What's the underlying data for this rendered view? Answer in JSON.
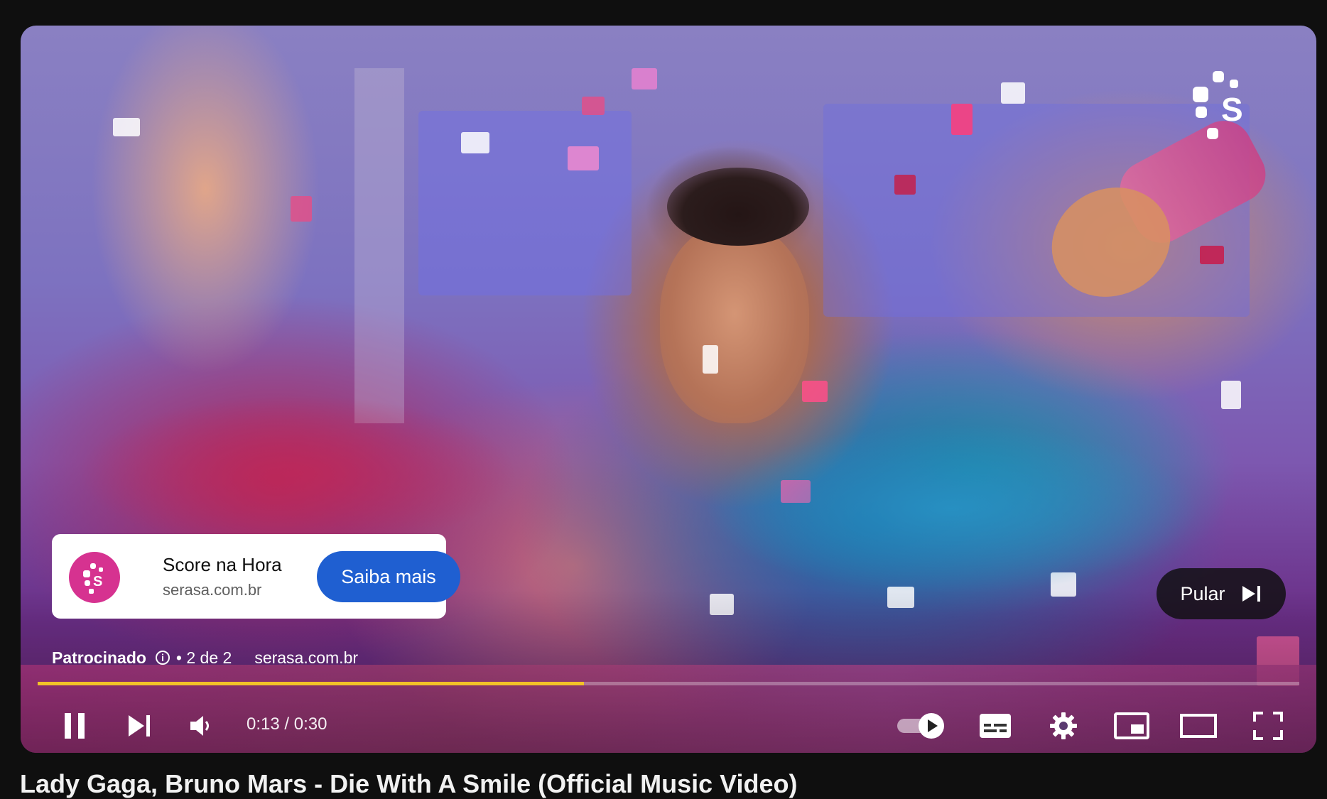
{
  "player": {
    "ad": {
      "advertiser_name": "Score na Hora",
      "advertiser_domain": "serasa.com.br",
      "cta_label": "Saiba mais",
      "sponsored_label": "Patrocinado",
      "ad_count": "• 2 de 2",
      "meta_domain": "serasa.com.br"
    },
    "skip_label": "Pular",
    "progress_fraction": 0.433,
    "time": {
      "current": "0:13",
      "separator": " / ",
      "duration": "0:30"
    },
    "controls": {
      "play_pause_icon": "pause-icon",
      "next_icon": "skip-next-icon",
      "volume_icon": "volume-icon",
      "autoplay_icon": "autoplay-toggle-icon",
      "subtitles_icon": "subtitles-icon",
      "settings_icon": "gear-icon",
      "miniplayer_icon": "miniplayer-icon",
      "theater_icon": "theater-mode-icon",
      "fullscreen_icon": "fullscreen-icon"
    },
    "colors": {
      "progress": "#f2c228",
      "cta": "#1f5fd1",
      "brand": "#d63290"
    }
  },
  "video_title": "Lady Gaga, Bruno Mars - Die With A Smile (Official Music Video)"
}
